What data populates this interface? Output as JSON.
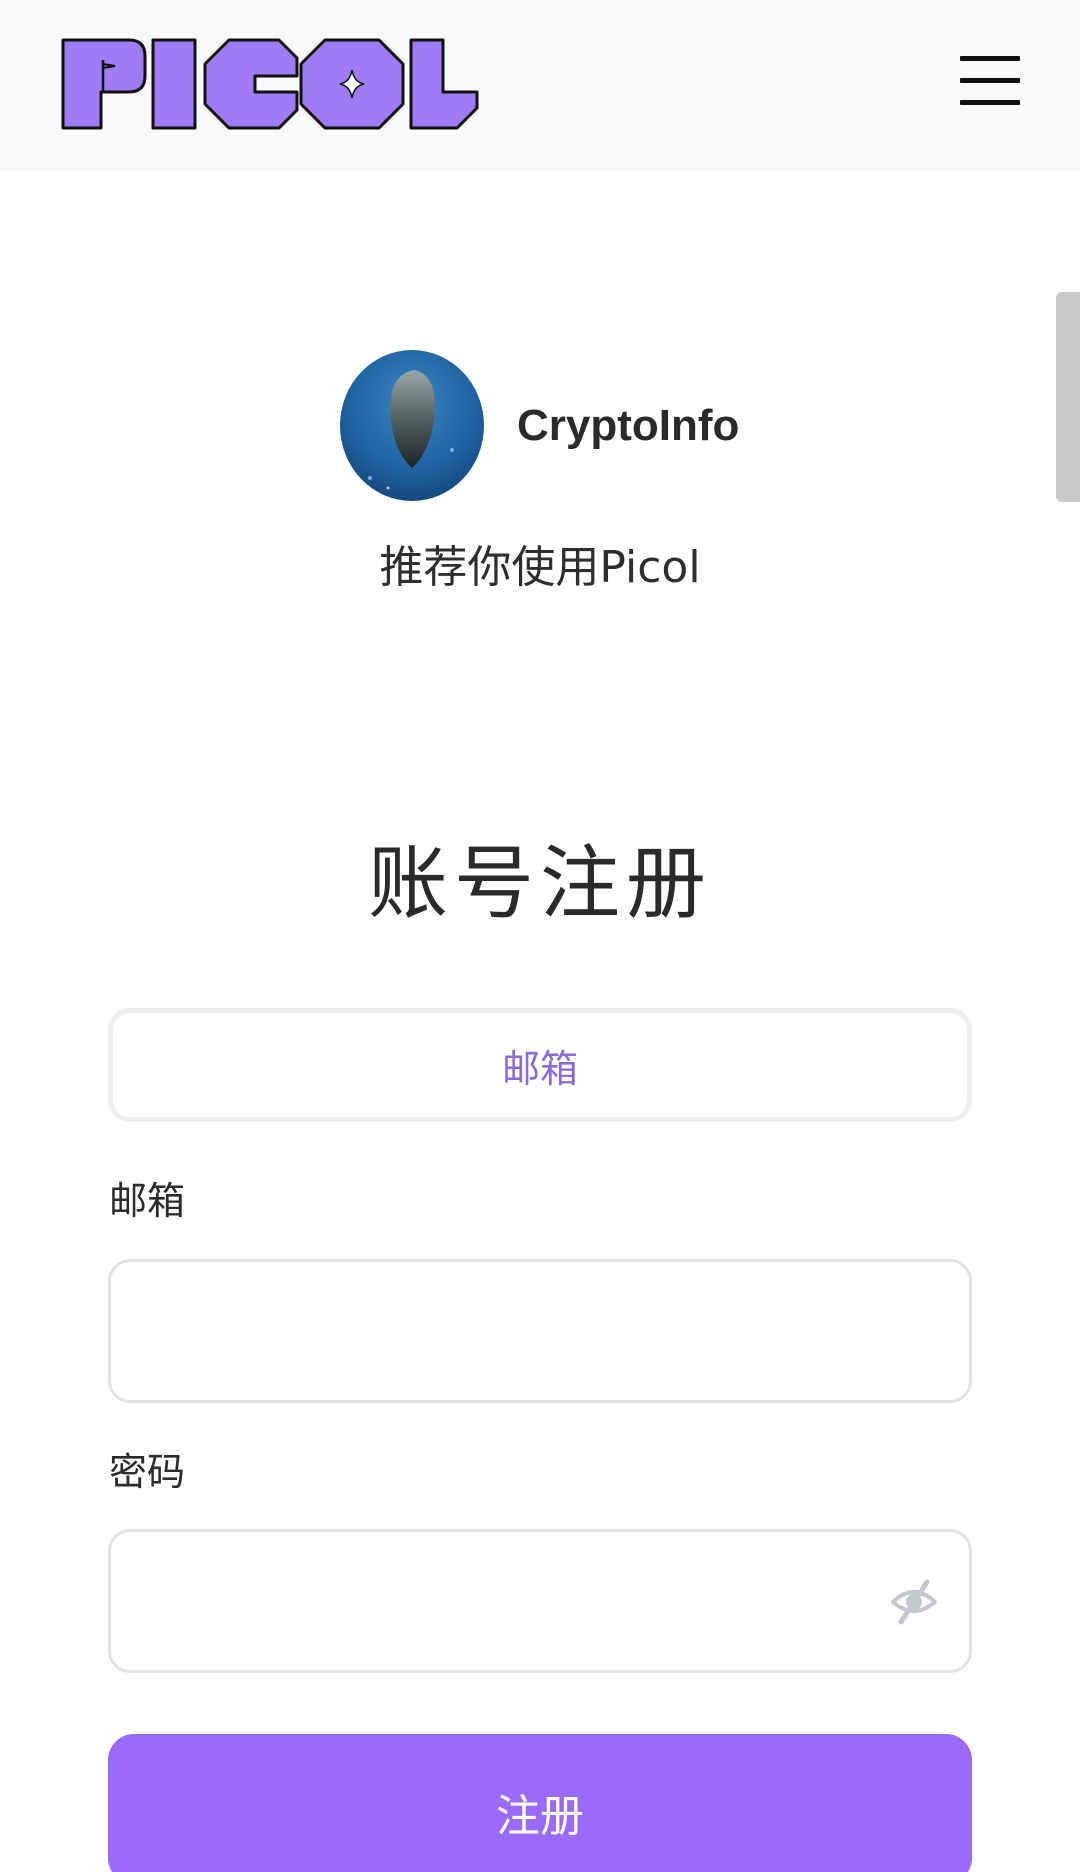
{
  "header": {
    "logo_text": "PICOL",
    "menu_icon": "hamburger-menu-icon"
  },
  "referrer": {
    "name": "CryptoInfo",
    "message": "推荐你使用Picol"
  },
  "page_title": "账号注册",
  "tabs": [
    {
      "label": "邮箱",
      "active": true
    }
  ],
  "form": {
    "email_label": "邮箱",
    "email_value": "",
    "password_label": "密码",
    "password_value": "",
    "password_toggle_icon": "eye-off-icon",
    "submit_label": "注册"
  },
  "colors": {
    "accent": "#9a6afb",
    "tab_text": "#8b6ad9",
    "logo_fill": "#9e7cf4"
  }
}
